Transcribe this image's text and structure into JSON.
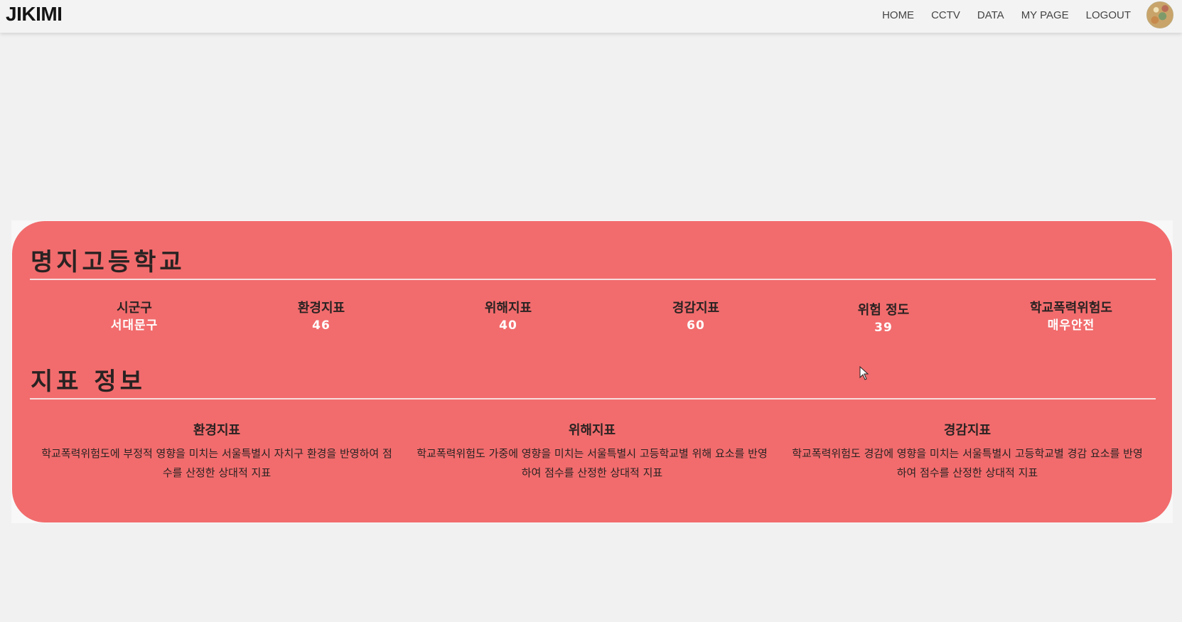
{
  "app": {
    "logo": "JIKIMI"
  },
  "nav": {
    "items": [
      {
        "label": "HOME"
      },
      {
        "label": "CCTV"
      },
      {
        "label": "DATA"
      },
      {
        "label": "MY PAGE"
      },
      {
        "label": "LOGOUT"
      }
    ],
    "avatar_icon": "user-avatar"
  },
  "school": {
    "name": "명지고등학교",
    "stats": [
      {
        "label": "시군구",
        "value": "서대문구"
      },
      {
        "label": "환경지표",
        "value": "46"
      },
      {
        "label": "위해지표",
        "value": "40"
      },
      {
        "label": "경감지표",
        "value": "60"
      },
      {
        "label": "위험 정도",
        "value": "39"
      },
      {
        "label": "학교폭력위험도",
        "value": "매우안전"
      }
    ]
  },
  "indicators": {
    "title": "지표 정보",
    "items": [
      {
        "title": "환경지표",
        "description": "학교폭력위험도에 부정적 영향을 미치는 서울특별시 자치구 환경을 반영하여 점수를 산정한 상대적 지표"
      },
      {
        "title": "위해지표",
        "description": "학교폭력위험도 가중에 영향을 미치는 서울특별시 고등학교별 위해 요소를 반영하여 점수를 산정한 상대적 지표"
      },
      {
        "title": "경감지표",
        "description": "학교폭력위험도 경감에 영향을 미치는 서울특별시 고등학교별 경감 요소를 반영하여 점수를 산정한 상대적 지표"
      }
    ]
  },
  "colors": {
    "card_background": "#f26c6d",
    "page_background": "#f1f1f1",
    "navbar_background": "#f3f3f3",
    "value_text": "#ffffff",
    "label_text": "#2a2222"
  }
}
